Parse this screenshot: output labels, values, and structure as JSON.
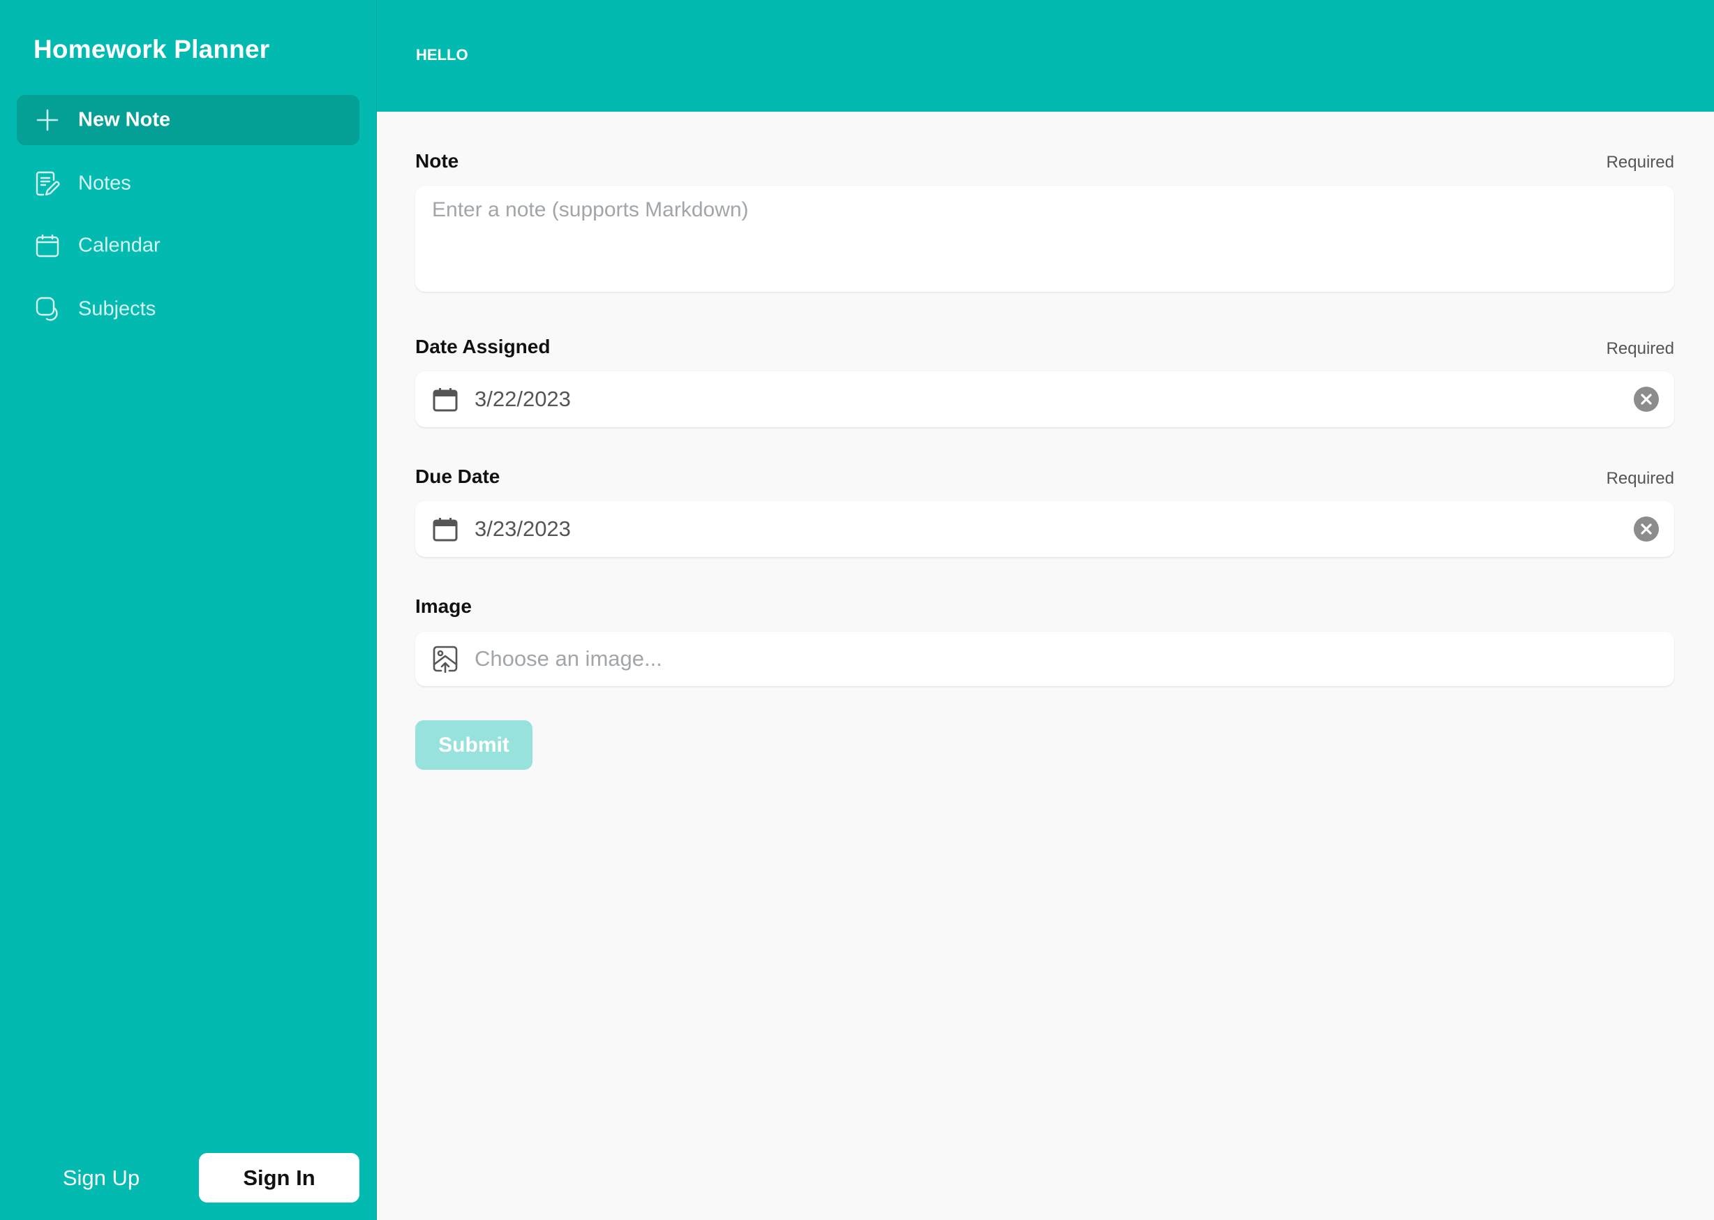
{
  "sidebar": {
    "app_title": "Homework Planner",
    "items": [
      {
        "label": "New Note",
        "icon": "plus-icon",
        "active": true
      },
      {
        "label": "Notes",
        "icon": "note-edit-icon",
        "active": false
      },
      {
        "label": "Calendar",
        "icon": "calendar-icon",
        "active": false
      },
      {
        "label": "Subjects",
        "icon": "subjects-icon",
        "active": false
      }
    ],
    "sign_up_label": "Sign Up",
    "sign_in_label": "Sign In"
  },
  "header": {
    "greeting": "HELLO"
  },
  "form": {
    "note": {
      "label": "Note",
      "required_label": "Required",
      "value": "",
      "placeholder": "Enter a note (supports Markdown)"
    },
    "date_assigned": {
      "label": "Date Assigned",
      "required_label": "Required",
      "value": "3/22/2023",
      "icon": "calendar-icon",
      "clear_icon": "clear-icon"
    },
    "due_date": {
      "label": "Due Date",
      "required_label": "Required",
      "value": "3/23/2023",
      "icon": "calendar-icon",
      "clear_icon": "clear-icon"
    },
    "image": {
      "label": "Image",
      "placeholder": "Choose an image...",
      "icon": "image-upload-icon"
    },
    "submit_label": "Submit",
    "submit_disabled": true
  },
  "colors": {
    "brand": "#02bab0",
    "brand_active": "#04a095",
    "submit_disabled": "#98e2dd",
    "background": "#f9f9f9"
  }
}
